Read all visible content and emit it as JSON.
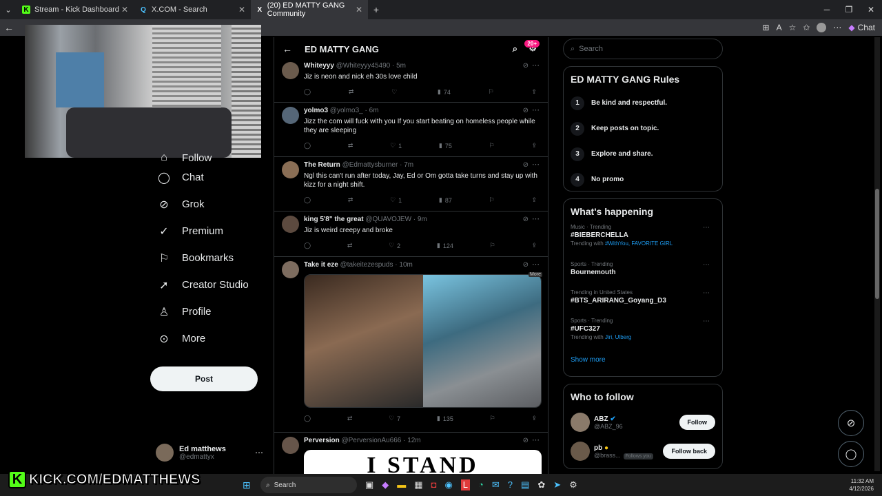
{
  "browser": {
    "tabs": [
      {
        "favicon": "K",
        "label": "Stream - Kick Dashboard",
        "active": false
      },
      {
        "favicon": "Q",
        "label": "X.COM - Search",
        "active": false
      },
      {
        "favicon": "X",
        "label": "(20) ED MATTY GANG Community",
        "active": true
      }
    ],
    "chat_label": "Chat"
  },
  "nav": {
    "items": [
      {
        "icon": "follow-icon",
        "label": "Follow"
      },
      {
        "icon": "chat-icon",
        "label": "Chat"
      },
      {
        "icon": "grok-icon",
        "label": "Grok"
      },
      {
        "icon": "premium-icon",
        "label": "Premium"
      },
      {
        "icon": "bookmark-icon",
        "label": "Bookmarks"
      },
      {
        "icon": "rocket-icon",
        "label": "Creator Studio"
      },
      {
        "icon": "profile-icon",
        "label": "Profile"
      },
      {
        "icon": "more-icon",
        "label": "More"
      }
    ],
    "post_label": "Post",
    "account": {
      "name": "Ed matthews",
      "handle": "@edmattyx"
    }
  },
  "feed": {
    "title": "ED MATTY GANG",
    "badge": "20+",
    "tweets": [
      {
        "name": "Whiteyyy",
        "handle": "@Whiteyyy45490",
        "time": "5m",
        "text": "Jiz is neon and nick eh 30s love child",
        "likes": "",
        "views": "74"
      },
      {
        "name": "yolmo3",
        "handle": "@yolmo3_",
        "time": "6m",
        "text": "Jizz the com will fuck with you If you start beating on homeless people while they are sleeping",
        "likes": "1",
        "views": "75"
      },
      {
        "name": "The Return",
        "handle": "@Edmattysburner",
        "time": "7m",
        "text": "Ngl this can't run after today, Jay, Ed or Om gotta take turns and stay up with kizz for a night shift.",
        "likes": "1",
        "views": "87"
      },
      {
        "name": "king 5'8\" the great",
        "handle": "@QUAVOJEW",
        "time": "9m",
        "text": "Jiz is weird creepy and broke",
        "likes": "2",
        "views": "124"
      },
      {
        "name": "Take it eze",
        "handle": "@takeitezespuds",
        "time": "10m",
        "text": "",
        "likes": "7",
        "views": "135",
        "tooltip": "More"
      },
      {
        "name": "Perversion",
        "handle": "@PerversionAu666",
        "time": "12m",
        "text": "",
        "media_text": "I STAND"
      }
    ]
  },
  "sidebar": {
    "search_placeholder": "Search",
    "rules_title": "ED MATTY GANG Rules",
    "rules": [
      {
        "num": "1",
        "text": "Be kind and respectful."
      },
      {
        "num": "2",
        "text": "Keep posts on topic."
      },
      {
        "num": "3",
        "text": "Explore and share."
      },
      {
        "num": "4",
        "text": "No promo"
      }
    ],
    "happening_title": "What's happening",
    "trends": [
      {
        "cat": "Music · Trending",
        "name": "#BIEBERCHELLA",
        "with_prefix": "Trending with",
        "with": "#WithYou, FAVORITE GIRL"
      },
      {
        "cat": "Sports · Trending",
        "name": "Bournemouth",
        "with_prefix": "",
        "with": ""
      },
      {
        "cat": "Trending in United States",
        "name": "#BTS_ARIRANG_Goyang_D3",
        "with_prefix": "",
        "with": ""
      },
      {
        "cat": "Sports · Trending",
        "name": "#UFC327",
        "with_prefix": "Trending with",
        "with": "Jiri, Ulberg"
      }
    ],
    "show_more": "Show more",
    "who_title": "Who to follow",
    "follows": [
      {
        "name": "ABZ",
        "handle": "@ABZ_96",
        "btn": "Follow",
        "follows_you": ""
      },
      {
        "name": "pb",
        "handle": "@brass...",
        "btn": "Follow back",
        "follows_you": "Follows you"
      }
    ]
  },
  "overlay": {
    "kick_text": "KICK.COM/EDMATTHEWS"
  },
  "taskbar": {
    "search": "Search",
    "time": "11:32 AM",
    "date": "4/12/2026"
  }
}
